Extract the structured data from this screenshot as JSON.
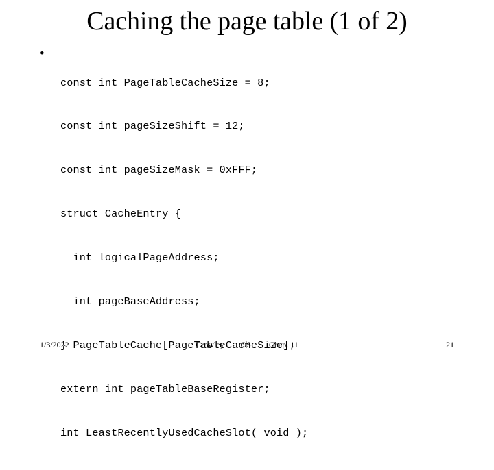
{
  "slide": {
    "title": "Caching the page table (1 of 2)",
    "background_color": "#ffffff",
    "text_color": "#000000"
  },
  "content": {
    "bullet_glyph": "•",
    "code_lines": [
      "const int PageTableCacheSize = 8;",
      "const int pageSizeShift = 12;",
      "const int pageSizeMask = 0xFFF;",
      "struct CacheEntry {",
      "  int logicalPageAddress;",
      "  int pageBaseAddress;",
      "} PageTableCache[PageTableCacheSize];",
      "extern int pageTableBaseRegister;",
      "int LeastRecentlyUsedCacheSlot( void );"
    ]
  },
  "footer": {
    "date": "1/3/2022",
    "author": "Crowley",
    "course": "OS",
    "chapter": "Chap. 11",
    "page_number": "21"
  }
}
